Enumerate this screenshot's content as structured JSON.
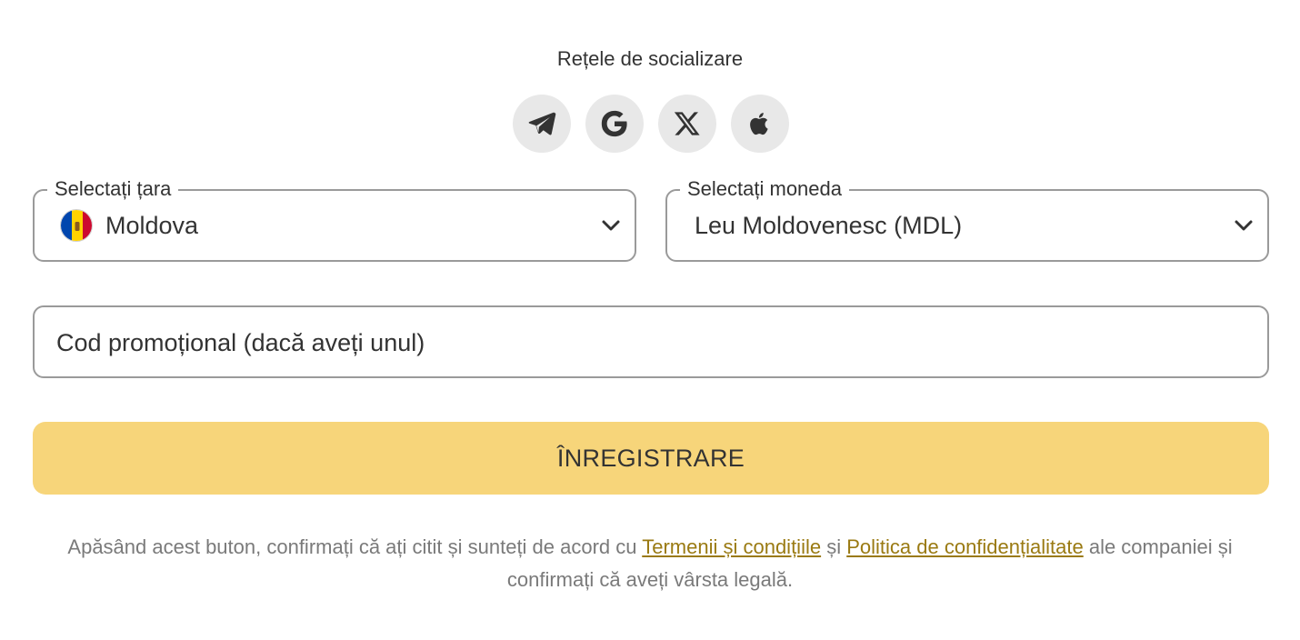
{
  "social": {
    "title": "Rețele de socializare",
    "icons": [
      "telegram-icon",
      "google-icon",
      "x-icon",
      "apple-icon"
    ]
  },
  "country": {
    "label": "Selectați țara",
    "value": "Moldova",
    "flag_icon": "moldova-flag-icon"
  },
  "currency": {
    "label": "Selectați moneda",
    "value": "Leu Moldovenesc (MDL)"
  },
  "promo": {
    "placeholder": "Cod promoțional (dacă aveți unul)",
    "value": ""
  },
  "register": {
    "label": "ÎNREGISTRARE"
  },
  "disclaimer": {
    "part1": "Apăsând acest buton, confirmați că ați citit și sunteți de acord cu ",
    "terms_link": "Termenii și condițiile",
    "part2": " și ",
    "privacy_link": "Politica de confidențialitate",
    "part3": " ale companiei și confirmați că aveți vârsta legală."
  },
  "colors": {
    "accent": "#f7d57a",
    "link": "#9a7a12",
    "border": "#9a9a9a",
    "social_bg": "#e8e8e8"
  }
}
